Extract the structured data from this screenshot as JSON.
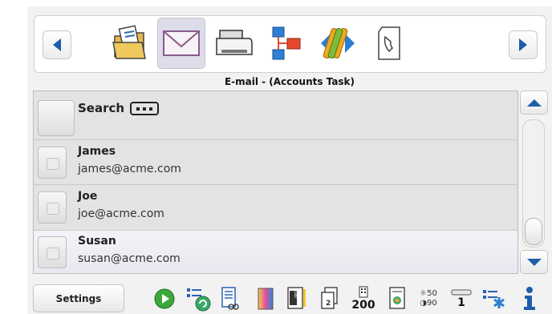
{
  "toolbar": {
    "apps": [
      {
        "name": "Documents",
        "icon": "folder-document-icon"
      },
      {
        "name": "E-mail",
        "icon": "envelope-icon"
      },
      {
        "name": "Print",
        "icon": "printer-icon"
      },
      {
        "name": "Network",
        "icon": "network-icon"
      },
      {
        "name": "Exchange",
        "icon": "exchange-icon"
      },
      {
        "name": "Phone",
        "icon": "phone-icon"
      }
    ]
  },
  "task_title": "E-mail - (Accounts Task)",
  "list": {
    "search_label": "Search",
    "contacts": [
      {
        "name": "James",
        "email": "james@acme.com"
      },
      {
        "name": "Joe",
        "email": "joe@acme.com"
      },
      {
        "name": "Susan",
        "email": "susan@acme.com"
      }
    ]
  },
  "footer": {
    "settings_label": "Settings",
    "pages_count": "200",
    "brightness": "50",
    "contrast": "90",
    "copies": "1"
  },
  "colors": {
    "accent": "#1d5ea8",
    "list_bg": "#e3e3e3",
    "selected_row": "#ededf3"
  }
}
